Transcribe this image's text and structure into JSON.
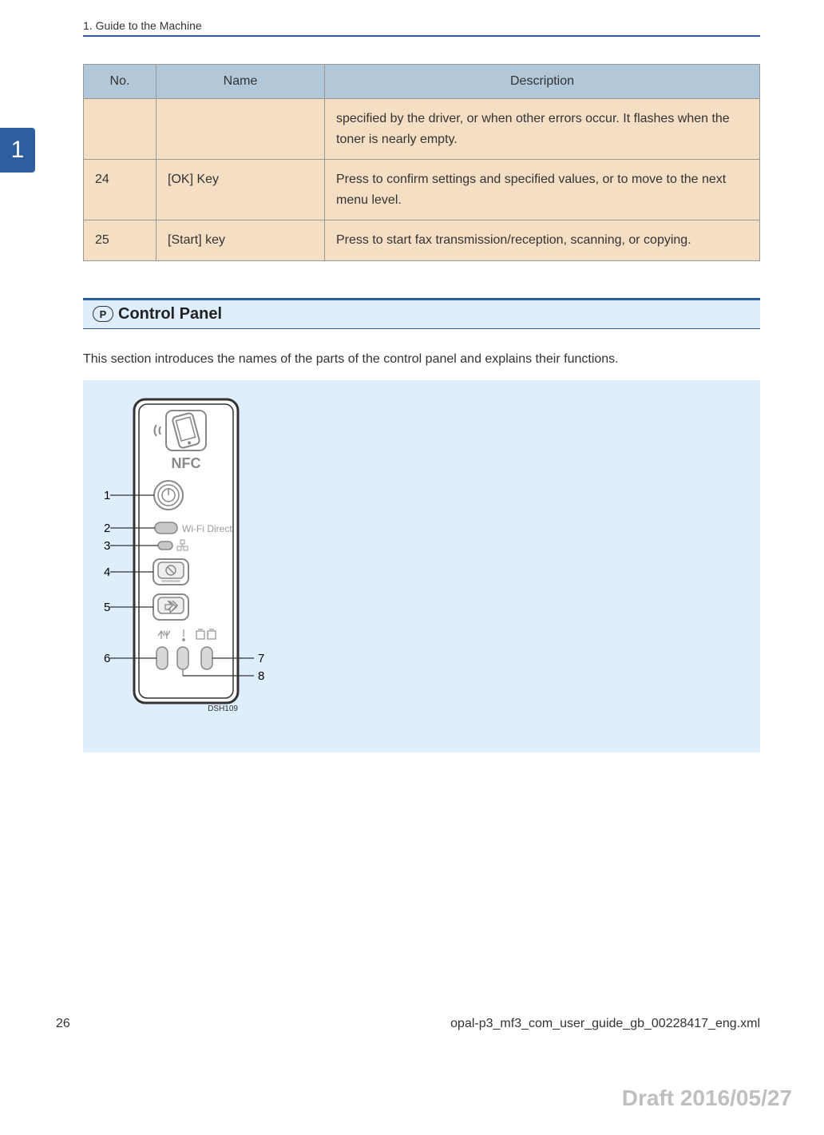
{
  "header": {
    "chapter_title": "1. Guide to the Machine",
    "chapter_number": "1"
  },
  "table": {
    "headers": {
      "no": "No.",
      "name": "Name",
      "description": "Description"
    },
    "rows": [
      {
        "no": "",
        "name": "",
        "description": "specified by the driver, or when other errors occur. It flashes when the toner is nearly empty."
      },
      {
        "no": "24",
        "name": "[OK] Key",
        "description": "Press to confirm settings and specified values, or to move to the next menu level."
      },
      {
        "no": "25",
        "name": "[Start] key",
        "description": "Press to start fax transmission/reception, scanning, or copying."
      }
    ]
  },
  "section": {
    "p_icon": "P",
    "title": "Control Panel",
    "intro": "This section introduces the names of the parts of the control panel and explains their functions."
  },
  "diagram": {
    "nfc_label": "NFC",
    "wifi_label": "Wi-Fi Direct",
    "code": "DSH109",
    "callouts": {
      "c1": "1",
      "c2": "2",
      "c3": "3",
      "c4": "4",
      "c5": "5",
      "c6": "6",
      "c7": "7",
      "c8": "8"
    }
  },
  "footer": {
    "page_number": "26",
    "filename": "opal-p3_mf3_com_user_guide_gb_00228417_eng.xml",
    "draft": "Draft 2016/05/27"
  }
}
